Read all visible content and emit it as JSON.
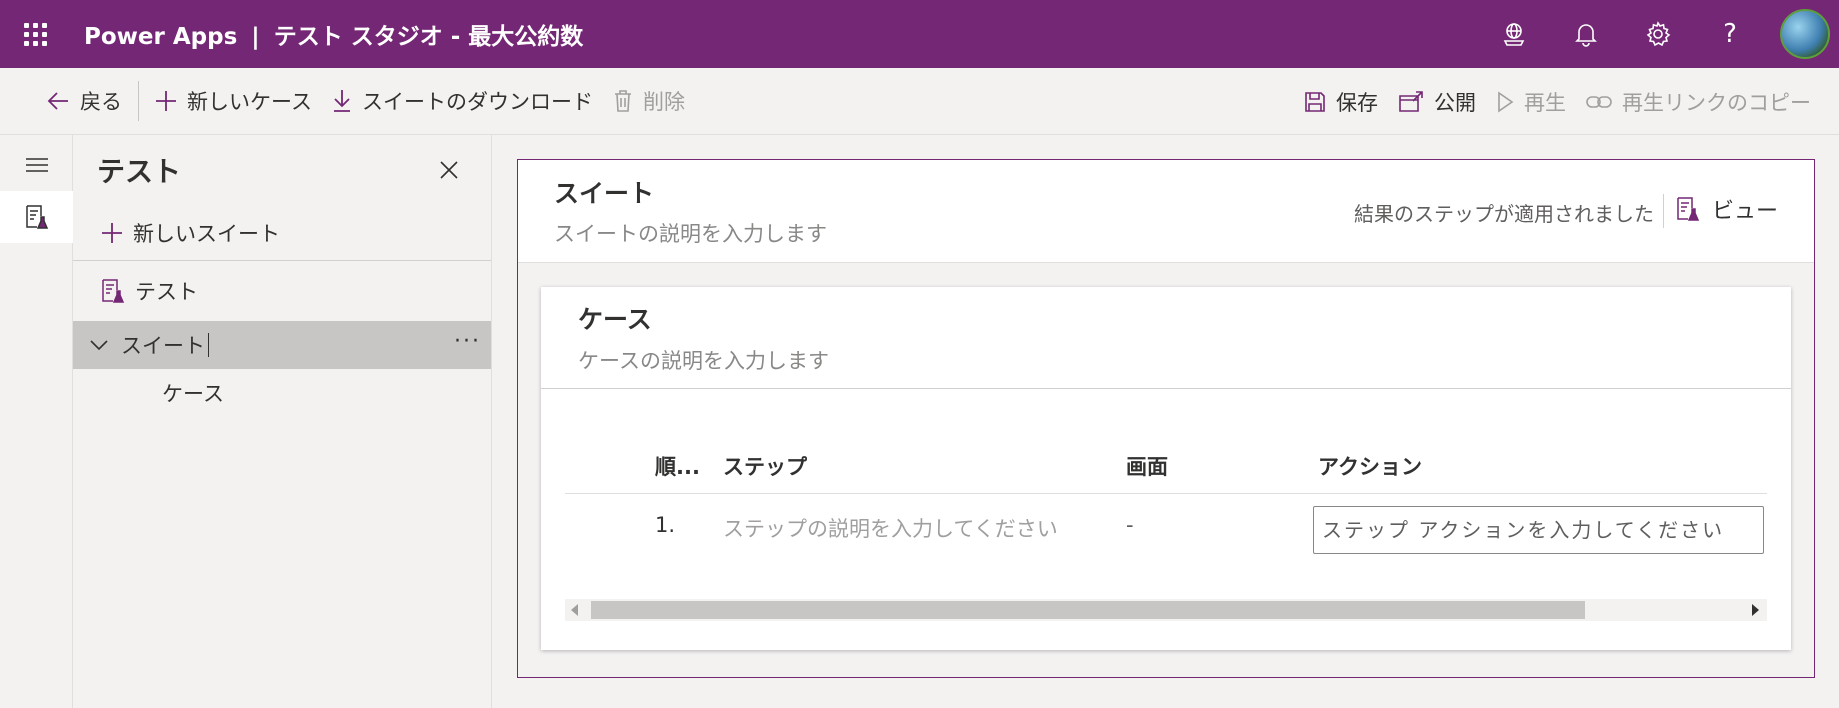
{
  "header": {
    "app_name": "Power Apps",
    "separator": "|",
    "studio_title": "テスト スタジオ - 最大公約数",
    "icons": [
      "waffle-icon",
      "environment-icon",
      "bell-icon",
      "gear-icon",
      "help-icon",
      "avatar"
    ],
    "help_glyph": "?",
    "brand_color": "#742774"
  },
  "commandbar": {
    "back": "戻る",
    "new_case": "新しいケース",
    "download_suite": "スイートのダウンロード",
    "delete": "削除",
    "save": "保存",
    "publish": "公開",
    "play": "再生",
    "copy_play_link": "再生リンクのコピー"
  },
  "tree": {
    "title": "テスト",
    "new_suite": "新しいスイート",
    "test_item": "テスト",
    "suite_item": "スイート",
    "more": "···",
    "case_item": "ケース"
  },
  "suite": {
    "name": "スイート",
    "description_placeholder": "スイートの説明を入力します",
    "status": "結果のステップが適用されました",
    "view": "ビュー"
  },
  "case": {
    "name": "ケース",
    "description_placeholder": "ケースの説明を入力します",
    "columns": {
      "order": "順...",
      "step": "ステップ",
      "screen": "画面",
      "action": "アクション"
    },
    "rows": [
      {
        "order": "1.",
        "step_placeholder": "ステップの説明を入力してください",
        "screen": "-",
        "action_placeholder": "ステップ アクションを入力してください"
      }
    ]
  }
}
